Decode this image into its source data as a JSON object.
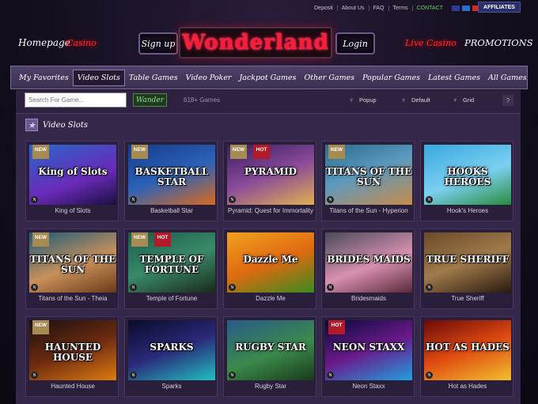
{
  "topbar": {
    "links": [
      "Deposit",
      "About Us",
      "FAQ",
      "Terms",
      "CONTACT"
    ],
    "flags": [
      {
        "name": "uk-flag",
        "color": "#2a3f9a"
      },
      {
        "name": "sweden-flag",
        "color": "#2c6fc6"
      },
      {
        "name": "canada-flag",
        "color": "#d52b1e"
      },
      {
        "name": "germany-flag",
        "color": "#d4a017"
      },
      {
        "name": "spain-flag",
        "color": "#c60b1e"
      },
      {
        "name": "finland-flag",
        "color": "#e8e8f2"
      }
    ],
    "affiliates": "AFFILIATES"
  },
  "header": {
    "homepage": "Homepage",
    "casino": "Casino",
    "signup": "Sign up",
    "logo": "Wonderland",
    "login": "Login",
    "live_casino": "Live Casino",
    "promotions": "PROMOTIONS"
  },
  "nav": {
    "items": [
      "My Favorites",
      "Video Slots",
      "Table Games",
      "Video Poker",
      "Jackpot Games",
      "Other Games",
      "Popular Games",
      "Latest Games",
      "All Games"
    ],
    "active": "Video Slots"
  },
  "toolbar": {
    "search_placeholder": "Search For Game...",
    "wander": "Wander",
    "count": "618+ Games",
    "popup": "Popup",
    "default": "Default",
    "grid": "Grid",
    "help": "?"
  },
  "section": {
    "title": "Video Slots"
  },
  "games": [
    {
      "title": "King of Slots",
      "art": "King of Slots",
      "badges": [
        "NEW"
      ],
      "bg": "linear-gradient(160deg,#2a66c9,#6a2ab8 60%,#1a1040)",
      "ne": true
    },
    {
      "title": "Basketball Star",
      "art": "BASKETBALL STAR",
      "badges": [
        "NEW"
      ],
      "bg": "linear-gradient(160deg,#183a8a,#2a62b8 50%,#d86a20)",
      "ne": true
    },
    {
      "title": "Pyramid: Quest for Immortality",
      "art": "PYRAMID",
      "badges": [
        "NEW",
        "HOT"
      ],
      "bg": "linear-gradient(160deg,#3a1f5e,#8a4a9a 50%,#e0b050)",
      "ne": true
    },
    {
      "title": "Titans of the Sun - Hyperion",
      "art": "TITANS OF THE SUN",
      "badges": [
        "NEW"
      ],
      "bg": "linear-gradient(160deg,#2a6a8a,#5a9ac0 45%,#c88a4a)",
      "ne": true
    },
    {
      "title": "Hook's Heroes",
      "art": "HOOKS HEROES",
      "badges": [],
      "bg": "linear-gradient(160deg,#3aa8e0,#7ad0f0 55%,#2a8a3a)",
      "ne": true
    },
    {
      "title": "Titans of the Sun - Theia",
      "art": "TITANS OF THE SUN",
      "badges": [
        "NEW"
      ],
      "bg": "linear-gradient(160deg,#1a5a7a,#c8905a 55%,#6a3a1a)",
      "ne": true
    },
    {
      "title": "Temple of Fortune",
      "art": "TEMPLE OF FORTUNE",
      "badges": [
        "NEW",
        "HOT"
      ],
      "bg": "linear-gradient(160deg,#1a5a4a,#3a8a6a 50%,#1a2a1a)",
      "ne": true
    },
    {
      "title": "Dazzle Me",
      "art": "Dazzle Me",
      "badges": [],
      "bg": "linear-gradient(160deg,#f0a020,#e06a10 50%,#3a8a20)",
      "ne": true
    },
    {
      "title": "Bridesmaids",
      "art": "BRIDES MAIDS",
      "badges": [],
      "bg": "linear-gradient(160deg,#4a4a5a,#d890b0 55%,#5a2a3a)",
      "ne": true
    },
    {
      "title": "True Sheriff",
      "art": "TRUE SHERIFF",
      "badges": [],
      "bg": "linear-gradient(160deg,#6a4a2a,#a07a4a 50%,#2a1a10)",
      "ne": true
    },
    {
      "title": "Haunted House",
      "art": "HAUNTED HOUSE",
      "badges": [
        "NEW"
      ],
      "bg": "linear-gradient(160deg,#1a1010,#6a2a10 50%,#e07a10)",
      "ne": true
    },
    {
      "title": "Sparks",
      "art": "SPARKS",
      "badges": [],
      "bg": "linear-gradient(160deg,#0a0a2a,#2a2a7a 50%,#20c0c0)",
      "ne": true
    },
    {
      "title": "Rugby Star",
      "art": "RUGBY STAR",
      "badges": [],
      "bg": "linear-gradient(160deg,#2a5a8a,#3a8a4a 55%,#1a3a1a)",
      "ne": true
    },
    {
      "title": "Neon Staxx",
      "art": "NEON STAXX",
      "badges": [
        "HOT"
      ],
      "bg": "linear-gradient(160deg,#0a0a3a,#6a1a8a 50%,#20a0e0)",
      "ne": true
    },
    {
      "title": "Hot as Hades",
      "art": "HOT AS HADES",
      "badges": [],
      "bg": "linear-gradient(160deg,#6a0a0a,#e04a10 50%,#f0c030)",
      "ne": true
    }
  ]
}
